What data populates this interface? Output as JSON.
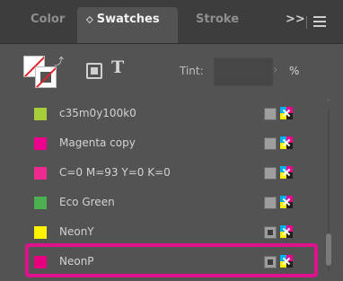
{
  "tabs": {
    "color": "Color",
    "swatches": "Swatches",
    "stroke": "Stroke",
    "overflow": ">>"
  },
  "toolbar": {
    "tint_label": "Tint:",
    "tint_value": "",
    "tint_unit": "%",
    "text_mode_label": "T"
  },
  "swatches": [
    {
      "name": "c35m0y100k0",
      "color": "#a6ce39"
    },
    {
      "name": "Magenta copy",
      "color": "#ec008c"
    },
    {
      "name": "C=0 M=93 Y=0 K=0",
      "color": "#ee2a90"
    },
    {
      "name": "Eco Green",
      "color": "#4caf50"
    },
    {
      "name": "NeonY",
      "color": "#fff200"
    },
    {
      "name": "NeonP",
      "color": "#e6007e"
    }
  ],
  "colors": {
    "highlight": "#e0118d"
  }
}
